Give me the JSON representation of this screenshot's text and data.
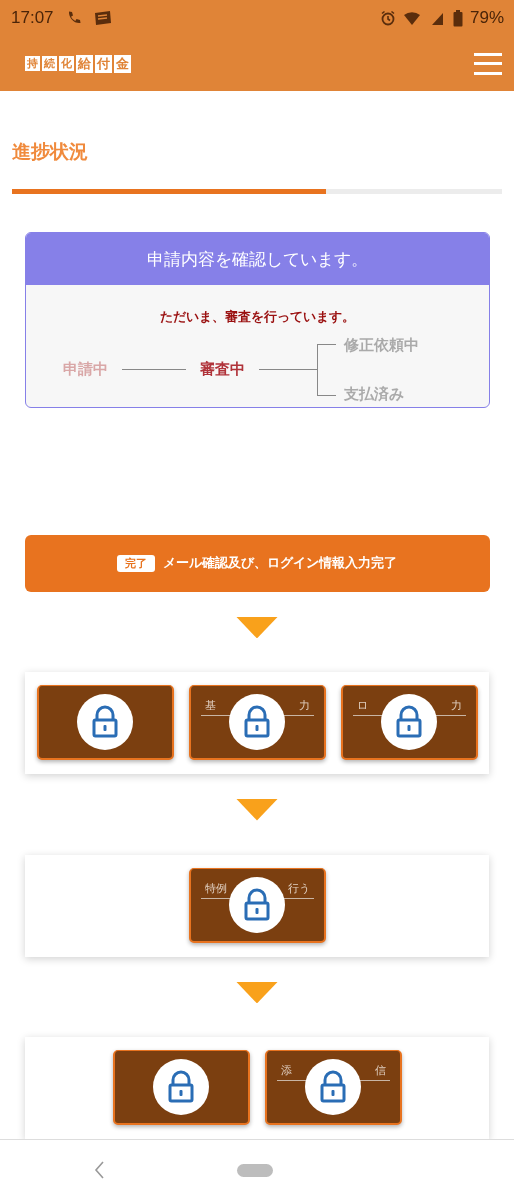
{
  "status_bar": {
    "time": "17:07",
    "battery": "79%"
  },
  "header": {
    "logo": [
      "持",
      "続",
      "化",
      "給",
      "付",
      "金"
    ]
  },
  "page_title": "進捗状況",
  "progress": {
    "level": 0.64
  },
  "status_card": {
    "title": "申請内容を確認しています。",
    "message": "ただいま、審査を行っています。",
    "steps": [
      {
        "label": "申請中",
        "done": true,
        "current": false
      },
      {
        "label": "審査中",
        "done": false,
        "current": true
      }
    ],
    "branches": [
      {
        "label": "修正依頼中",
        "done": false,
        "current": false
      },
      {
        "label": "支払済み",
        "done": false,
        "current": false
      }
    ]
  },
  "completed_banner": {
    "badge": "完了",
    "text": "メール確認及び、ログイン情報入力完了"
  },
  "step_groups": [
    {
      "tiles": [
        {
          "locked": true
        },
        {
          "locked": true,
          "left": "基",
          "right": "力"
        },
        {
          "locked": true,
          "left": "ロ",
          "right": "力"
        }
      ]
    },
    {
      "tiles": [
        {
          "locked": true,
          "left": "特例",
          "right": "行う"
        }
      ]
    },
    {
      "tiles": [
        {
          "locked": true
        },
        {
          "locked": true,
          "left": "添",
          "right": "信"
        }
      ]
    }
  ]
}
